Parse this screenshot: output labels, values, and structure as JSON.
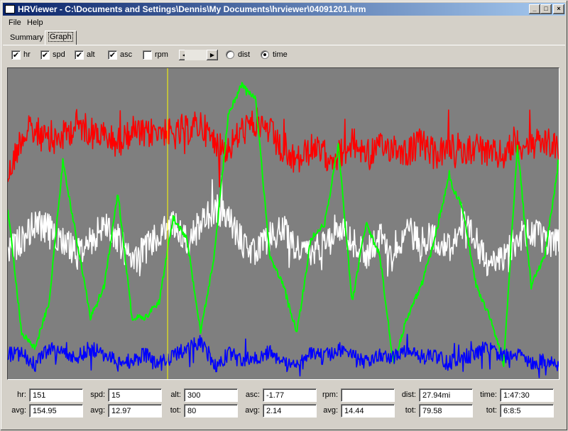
{
  "window": {
    "title": "HRViewer - C:\\Documents and Settings\\Dennis\\My Documents\\hrviewer\\04091201.hrm"
  },
  "title_buttons": {
    "minimize": "_",
    "maximize": "□",
    "close": "×"
  },
  "menu": [
    "File",
    "Help"
  ],
  "tabs": [
    "Summary",
    "Graph"
  ],
  "active_tab": "Graph",
  "controls": {
    "checkboxes": [
      {
        "label": "hr",
        "checked": true
      },
      {
        "label": "spd",
        "checked": true
      },
      {
        "label": "alt",
        "checked": true
      },
      {
        "label": "asc",
        "checked": true
      },
      {
        "label": "rpm",
        "checked": false
      }
    ],
    "nav": {
      "prev": "◀",
      "next": "▶"
    },
    "radios": [
      {
        "label": "dist",
        "selected": false
      },
      {
        "label": "time",
        "selected": true
      }
    ]
  },
  "stats": {
    "current": [
      {
        "label": "hr:",
        "value": "151"
      },
      {
        "label": "spd:",
        "value": "15"
      },
      {
        "label": "alt:",
        "value": "300"
      },
      {
        "label": "asc:",
        "value": "-1.77"
      },
      {
        "label": "rpm:",
        "value": ""
      },
      {
        "label": "dist:",
        "value": "27.94mi"
      },
      {
        "label": "time:",
        "value": "1:47:30"
      }
    ],
    "summary": [
      {
        "label": "avg:",
        "value": "154.95"
      },
      {
        "label": "avg:",
        "value": "12.97"
      },
      {
        "label": "tot:",
        "value": "80"
      },
      {
        "label": "avg:",
        "value": "2.14"
      },
      {
        "label": "avg:",
        "value": "14.44"
      },
      {
        "label": "tot:",
        "value": "79.58"
      },
      {
        "label": "tot:",
        "value": "6:8:5"
      }
    ]
  },
  "chart_data": {
    "type": "line",
    "x_axis": "time",
    "cursor_fraction": 0.29,
    "background": "#7f7f7f",
    "cursor_color": "#ffff00",
    "series": [
      {
        "color": "#ff0000",
        "base": [
          0.35,
          0.22,
          0.2,
          0.24,
          0.22,
          0.18,
          0.2,
          0.22,
          0.24,
          0.2,
          0.22,
          0.19,
          0.22,
          0.2,
          0.18,
          0.24,
          0.26,
          0.2,
          0.18,
          0.2,
          0.28,
          0.3,
          0.26,
          0.28,
          0.28,
          0.24,
          0.27,
          0.26,
          0.25,
          0.27,
          0.24,
          0.28,
          0.26,
          0.27,
          0.25,
          0.28,
          0.28,
          0.24,
          0.25,
          0.24,
          0.26
        ],
        "amplitude": 0.05
      },
      {
        "color": "#ffffff",
        "base": [
          0.6,
          0.55,
          0.5,
          0.52,
          0.55,
          0.6,
          0.56,
          0.5,
          0.55,
          0.62,
          0.58,
          0.54,
          0.5,
          0.56,
          0.5,
          0.45,
          0.48,
          0.56,
          0.6,
          0.54,
          0.52,
          0.58,
          0.6,
          0.55,
          0.5,
          0.56,
          0.6,
          0.54,
          0.58,
          0.52,
          0.56,
          0.54,
          0.58,
          0.5,
          0.56,
          0.64,
          0.6,
          0.55,
          0.52,
          0.56,
          0.55
        ],
        "amplitude": 0.05
      },
      {
        "color": "#00ff00",
        "base": [
          0.45,
          0.85,
          0.9,
          0.75,
          0.3,
          0.55,
          0.8,
          0.7,
          0.4,
          0.8,
          0.8,
          0.75,
          0.48,
          0.55,
          0.85,
          0.6,
          0.15,
          0.05,
          0.1,
          0.6,
          0.7,
          0.85,
          0.55,
          0.5,
          0.25,
          0.75,
          0.5,
          0.6,
          0.95,
          0.8,
          0.7,
          0.55,
          0.35,
          0.45,
          0.7,
          0.8,
          0.95,
          0.25,
          0.7,
          0.6,
          0.3
        ],
        "amplitude": 0.01
      },
      {
        "color": "#0000ff",
        "base": [
          0.92,
          0.92,
          0.95,
          0.9,
          0.92,
          0.93,
          0.9,
          0.92,
          0.95,
          0.94,
          0.92,
          0.95,
          0.93,
          0.9,
          0.88,
          0.96,
          0.92,
          0.94,
          0.93,
          0.91,
          0.95,
          0.96,
          0.92,
          0.93,
          0.9,
          0.92,
          0.95,
          0.92,
          0.93,
          0.9,
          0.93,
          0.92,
          0.95,
          0.93,
          0.92,
          0.9,
          0.93,
          0.92,
          0.95,
          0.94,
          0.96
        ],
        "amplitude": 0.025
      }
    ]
  }
}
